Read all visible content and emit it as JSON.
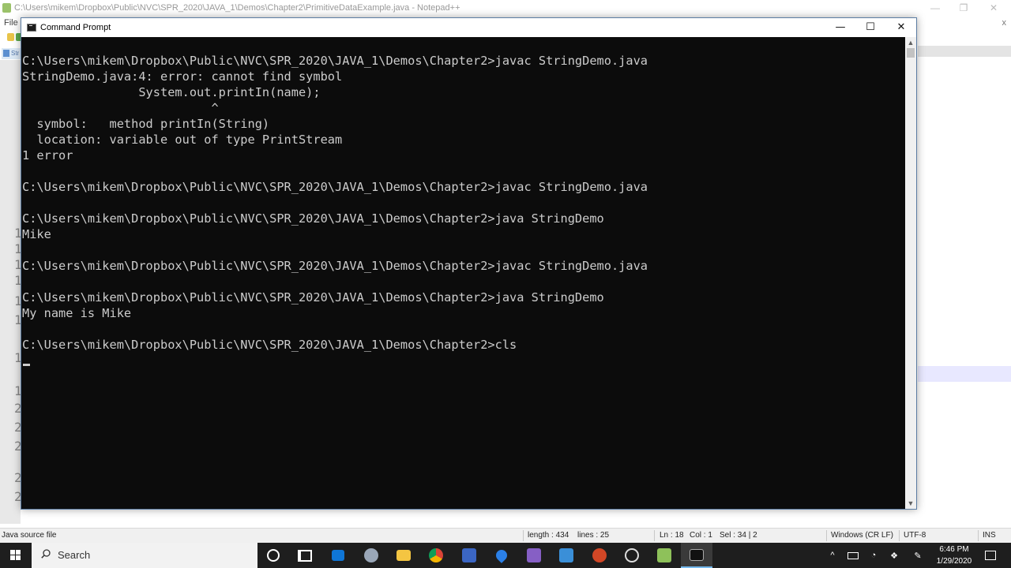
{
  "notepad": {
    "title": "C:\\Users\\mikem\\Dropbox\\Public\\NVC\\SPR_2020\\JAVA_1\\Demos\\Chapter2\\PrimitiveDataExample.java - Notepad++",
    "menu_file": "File",
    "menu_close": "x",
    "tab_label": "Str",
    "gutter_numbers": [
      "1",
      "1",
      "1",
      "1",
      "1",
      "1",
      "1",
      "1",
      "2",
      "2",
      "2",
      "2",
      "2"
    ],
    "status": {
      "file_type": "Java source file",
      "length": "length : 434",
      "lines": "lines : 25",
      "ln": "Ln : 18",
      "col": "Col : 1",
      "sel": "Sel : 34 | 2",
      "eol": "Windows (CR LF)",
      "encoding": "UTF-8",
      "mode": "INS"
    }
  },
  "cmd": {
    "title": "Command Prompt",
    "minimize": "—",
    "maximize": "☐",
    "close": "✕",
    "lines": [
      "C:\\Users\\mikem\\Dropbox\\Public\\NVC\\SPR_2020\\JAVA_1\\Demos\\Chapter2>javac StringDemo.java",
      "StringDemo.java:4: error: cannot find symbol",
      "                System.out.printIn(name);",
      "                          ^",
      "  symbol:   method printIn(String)",
      "  location: variable out of type PrintStream",
      "1 error",
      "",
      "C:\\Users\\mikem\\Dropbox\\Public\\NVC\\SPR_2020\\JAVA_1\\Demos\\Chapter2>javac StringDemo.java",
      "",
      "C:\\Users\\mikem\\Dropbox\\Public\\NVC\\SPR_2020\\JAVA_1\\Demos\\Chapter2>java StringDemo",
      "Mike",
      "",
      "C:\\Users\\mikem\\Dropbox\\Public\\NVC\\SPR_2020\\JAVA_1\\Demos\\Chapter2>javac StringDemo.java",
      "",
      "C:\\Users\\mikem\\Dropbox\\Public\\NVC\\SPR_2020\\JAVA_1\\Demos\\Chapter2>java StringDemo",
      "My name is Mike",
      "",
      "C:\\Users\\mikem\\Dropbox\\Public\\NVC\\SPR_2020\\JAVA_1\\Demos\\Chapter2>cls"
    ]
  },
  "taskbar": {
    "search_label": "Search",
    "time": "6:46 PM",
    "date": "1/29/2020",
    "apps": [
      "cortana",
      "task-view",
      "store",
      "app",
      "file-explorer",
      "chrome",
      "app",
      "maps",
      "visual-studio",
      "app",
      "powerpoint",
      "obs",
      "notepad-plus-plus",
      "command-prompt"
    ]
  },
  "colors": {
    "console_bg": "#0c0c0c",
    "console_text": "#cccccc",
    "taskbar_bg": "#1e1e1e",
    "active_indicator": "#76b9ed"
  }
}
